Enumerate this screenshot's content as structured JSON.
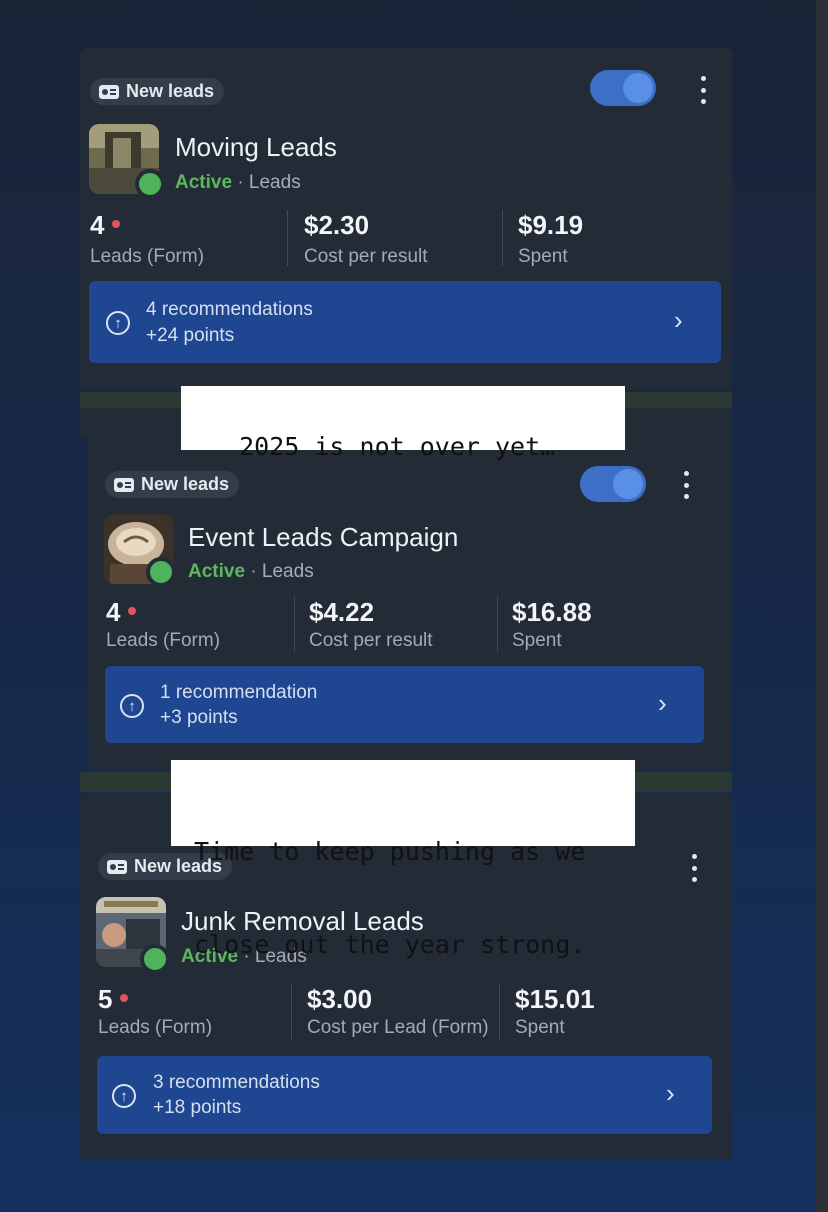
{
  "campaigns": [
    {
      "tag": "New leads",
      "name": "Moving Leads",
      "status": "Active",
      "type": "Leads",
      "metrics": [
        {
          "value": "4",
          "label": "Leads (Form)"
        },
        {
          "value": "$2.30",
          "label": "Cost per result"
        },
        {
          "value": "$9.19",
          "label": "Spent"
        }
      ],
      "recommendations": "4 recommendations",
      "points": "+24 points",
      "toggle_on": true
    },
    {
      "tag": "New leads",
      "name": "Event Leads Campaign",
      "status": "Active",
      "type": "Leads",
      "metrics": [
        {
          "value": "4",
          "label": "Leads (Form)"
        },
        {
          "value": "$4.22",
          "label": "Cost per result"
        },
        {
          "value": "$16.88",
          "label": "Spent"
        }
      ],
      "recommendations": "1 recommendation",
      "points": "+3 points",
      "toggle_on": true
    },
    {
      "tag": "New leads",
      "name": "Junk Removal Leads",
      "status": "Active",
      "type": "Leads",
      "metrics": [
        {
          "value": "5",
          "label": "Leads (Form)"
        },
        {
          "value": "$3.00",
          "label": "Cost per Lead (Form)"
        },
        {
          "value": "$15.01",
          "label": "Spent"
        }
      ],
      "recommendations": "3 recommendations",
      "points": "+18 points",
      "toggle_on": false
    }
  ],
  "separator": "·",
  "overlays": {
    "caption1": "2025 is not over yet…",
    "caption2_line1": "Time to keep pushing as we",
    "caption2_line2": "close out the year strong."
  },
  "icons": {
    "tag": "lead-form-icon",
    "recommendation": "arrow-up-circle-icon",
    "chevron": "chevron-right-icon",
    "more": "more-vertical-icon"
  },
  "colors": {
    "active": "#5cb85c",
    "toggle": "#3d6fc7",
    "recommendation_bg": "#1f4791",
    "metric_dot": "#e0555b"
  }
}
